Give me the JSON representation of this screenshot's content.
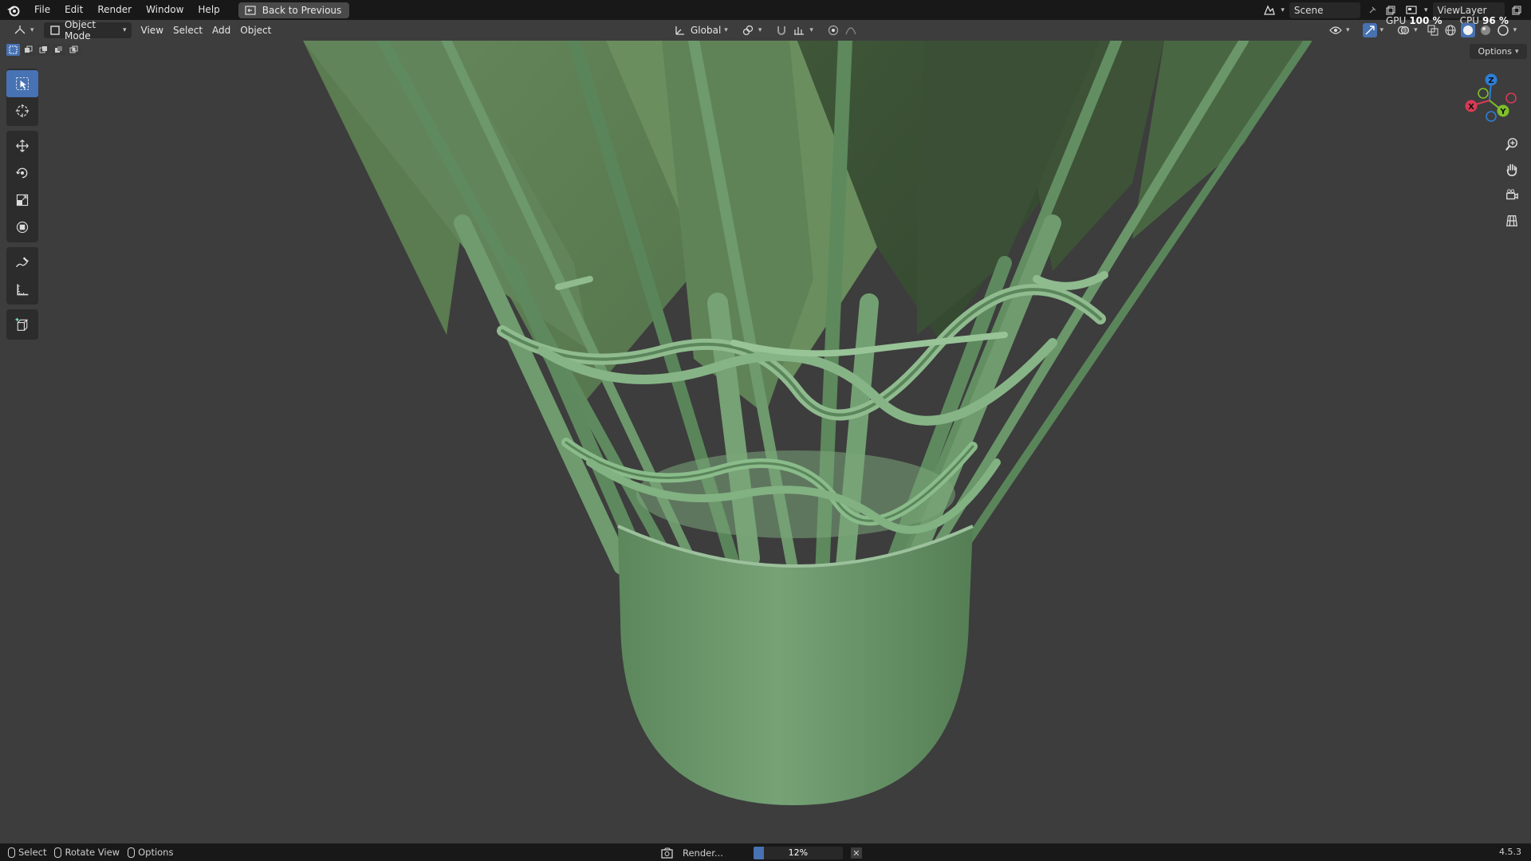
{
  "menubar": {
    "items": [
      "File",
      "Edit",
      "Render",
      "Window",
      "Help"
    ],
    "back_button": "Back to Previous",
    "scene": "Scene",
    "view_layer": "ViewLayer"
  },
  "performance": {
    "gpu_label": "GPU",
    "gpu_value": "100 %",
    "cpu_label": "CPU",
    "cpu_value": "96 %"
  },
  "viewport_header": {
    "mode": "Object Mode",
    "menus": [
      "View",
      "Select",
      "Add",
      "Object"
    ],
    "transform_orientation": "Global",
    "options": "Options"
  },
  "toolbar": {
    "tools": [
      "select-box-icon",
      "cursor-icon",
      "move-icon",
      "rotate-icon",
      "scale-icon",
      "transform-icon",
      "annotate-icon",
      "measure-icon",
      "add-cube-icon"
    ]
  },
  "gizmo": {
    "x": "X",
    "y": "Y",
    "z": "Z"
  },
  "statusbar": {
    "hints": [
      "Select",
      "Rotate View",
      "Options"
    ],
    "render_label": "Render...",
    "progress_text": "12%",
    "progress": 0.12,
    "version": "4.5.3"
  },
  "colors": {
    "accent": "#4772b3",
    "model_green": "#6f9a6f",
    "viewport_bg": "#3d3d3d"
  }
}
